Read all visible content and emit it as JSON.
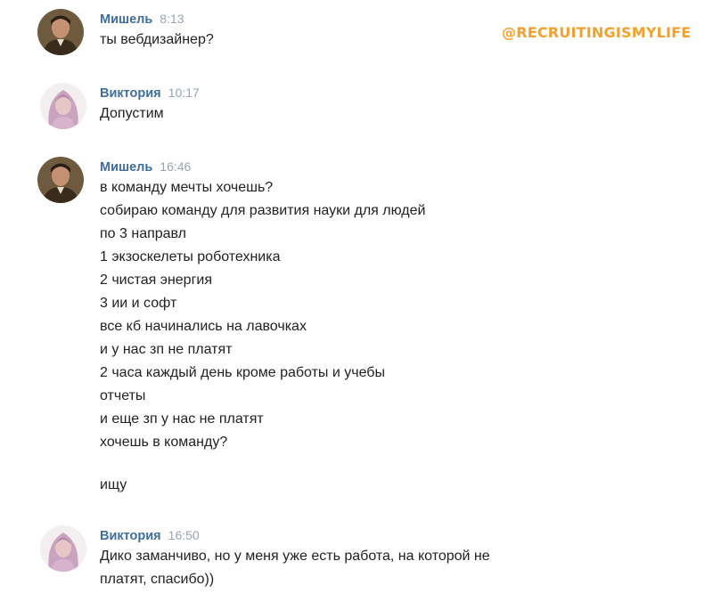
{
  "watermark": "@RECRUITINGISMYLIFE",
  "messages": [
    {
      "author": "Мишель",
      "time": "8:13",
      "lines": [
        "ты вебдизайнер?"
      ]
    },
    {
      "author": "Виктория",
      "time": "10:17",
      "lines": [
        "Допустим"
      ]
    },
    {
      "author": "Мишель",
      "time": "16:46",
      "lines": [
        "в команду мечты хочешь?",
        "собираю команду для развития науки для людей",
        "по 3 направл",
        "1 экзоскелеты роботехника",
        "2 чистая энергия",
        "3 ии и софт",
        "все кб начинались на лавочках",
        "и у нас зп не платят",
        "2 часа каждый день кроме работы и учебы",
        "отчеты",
        "и еще зп у нас не платят",
        "хочешь в команду?",
        "",
        "ищу"
      ]
    },
    {
      "author": "Виктория",
      "time": "16:50",
      "lines": [
        "Дико заманчиво, но у меня уже есть работа, на которой не",
        "платят, спасибо))"
      ]
    }
  ]
}
